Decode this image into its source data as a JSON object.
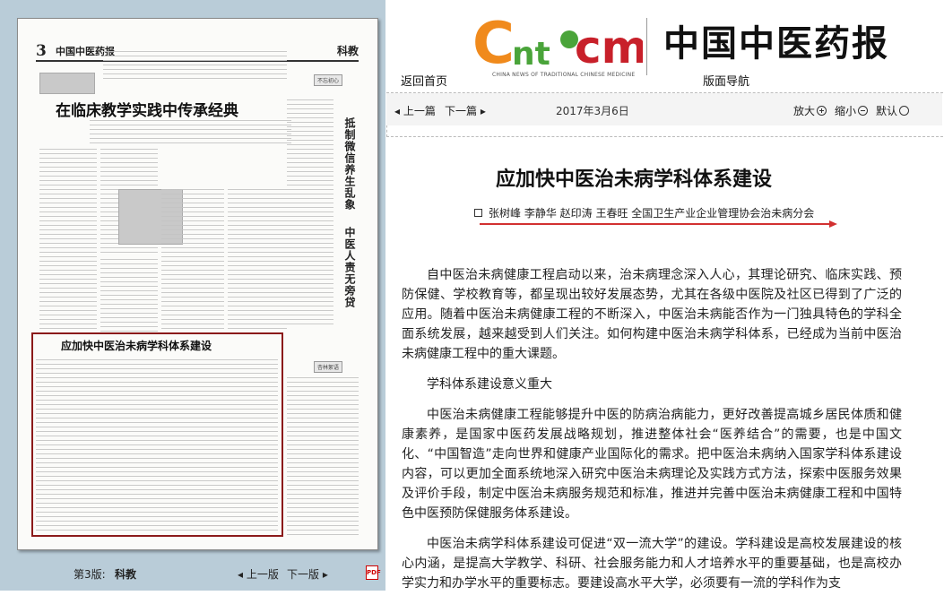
{
  "left": {
    "newspaper": {
      "page_num": "3",
      "brand": "中国中医药报",
      "section": "科教",
      "headline": "在临床教学实践中传承经典",
      "side_headline_1": "抵制微信养生乱象",
      "side_headline_2": "中医人责无旁贷",
      "selected_article_title": "应加快中医治未病学科体系建设",
      "box_tag": "杏林絮语",
      "corner_tag": "不忘初心"
    },
    "pagination": {
      "page_label": "第3版:",
      "section_name": "科教",
      "prev": "◂ 上一版",
      "next": "下一版 ▸",
      "pdf_label": "PDF"
    }
  },
  "header": {
    "logo_text": "CNtcm",
    "logo_sub": "CHINA NEWS OF TRADITIONAL CHINESE MEDICINE",
    "brand_title": "中国中医药报",
    "home_link": "返回首页",
    "nav_link": "版面导航"
  },
  "toolbar": {
    "prev_article": "◂ 上一篇",
    "next_article": "下一篇 ▸",
    "date": "2017年3月6日",
    "zoom_in": "放大",
    "zoom_out": "缩小",
    "default": "默认"
  },
  "article": {
    "title": "应加快中医治未病学科体系建设",
    "byline": "张树峰 李静华 赵印涛 王春旺 全国卫生产业企业管理协会治未病分会",
    "paragraphs": [
      "自中医治未病健康工程启动以来，治未病理念深入人心，其理论研究、临床实践、预防保健、学校教育等，都呈现出较好发展态势，尤其在各级中医院及社区已得到了广泛的应用。随着中医治未病健康工程的不断深入，中医治未病能否作为一门独具特色的学科全面系统发展，越来越受到人们关注。如何构建中医治未病学科体系，已经成为当前中医治未病健康工程中的重大课题。",
      "学科体系建设意义重大",
      "中医治未病健康工程能够提升中医的防病治病能力，更好改善提高城乡居民体质和健康素养，是国家中医药发展战略规划，推进整体社会“医养结合”的需要，也是中国文化、“中国智造”走向世界和健康产业国际化的需求。把中医治未病纳入国家学科体系建设内容，可以更加全面系统地深入研究中医治未病理论及实践方式方法，探索中医服务效果及评价手段，制定中医治未病服务规范和标准，推进并完善中医治未病健康工程和中国特色中医预防保健服务体系建设。",
      "中医治未病学科体系建设可促进“双一流大学”的建设。学科建设是高校发展建设的核心内涵，是提高大学教学、科研、社会服务能力和人才培养水平的重要基础，也是高校办学实力和办学水平的重要标志。要建设高水平大学，必须要有一流的学科作为支"
    ]
  },
  "colors": {
    "left_bg": "#b9ccd8",
    "highlight": "#8b1a1a",
    "title_rule": "#d23030",
    "logo_orange": "#f08a1c",
    "logo_green": "#4aa43a",
    "logo_red": "#c8202a"
  }
}
